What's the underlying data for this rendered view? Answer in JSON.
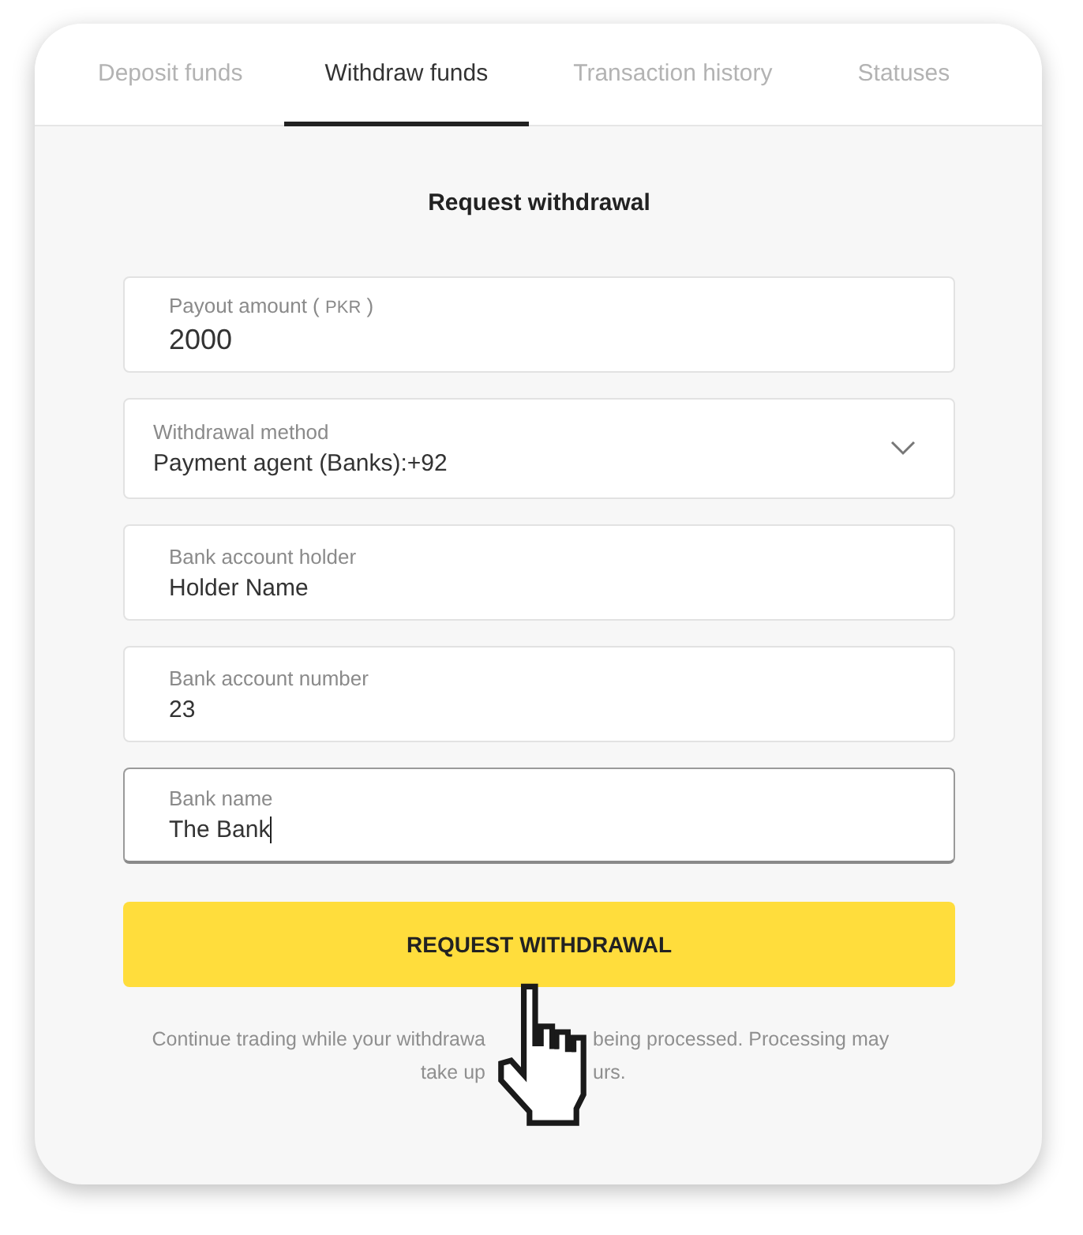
{
  "tabs": [
    {
      "label": "Deposit funds",
      "selected": false
    },
    {
      "label": "Withdraw funds",
      "selected": true
    },
    {
      "label": "Transaction history",
      "selected": false
    },
    {
      "label": "Statuses",
      "selected": false
    }
  ],
  "form": {
    "title": "Request withdrawal",
    "fields": [
      {
        "kind": "input",
        "label": "Payout amount (",
        "currency": "PKR",
        "label_end": ")",
        "value": "2000",
        "focused": false
      },
      {
        "kind": "select",
        "label": "Withdrawal method",
        "value": "Payment agent (Banks):+92",
        "focused": false
      },
      {
        "kind": "input",
        "label": "Bank account holder",
        "value": "Holder Name",
        "focused": false
      },
      {
        "kind": "input",
        "label": "Bank account number",
        "value": "23",
        "focused": false
      },
      {
        "kind": "input",
        "label": "Bank name",
        "value": "The Bank",
        "focused": true
      }
    ],
    "button": "REQUEST WITHDRAWAL",
    "note": [
      {
        "parts": [
          "Continue trading while your withdrawa",
          "being processed.  Processing may"
        ]
      },
      {
        "parts": [
          "take up",
          "urs."
        ]
      }
    ]
  }
}
